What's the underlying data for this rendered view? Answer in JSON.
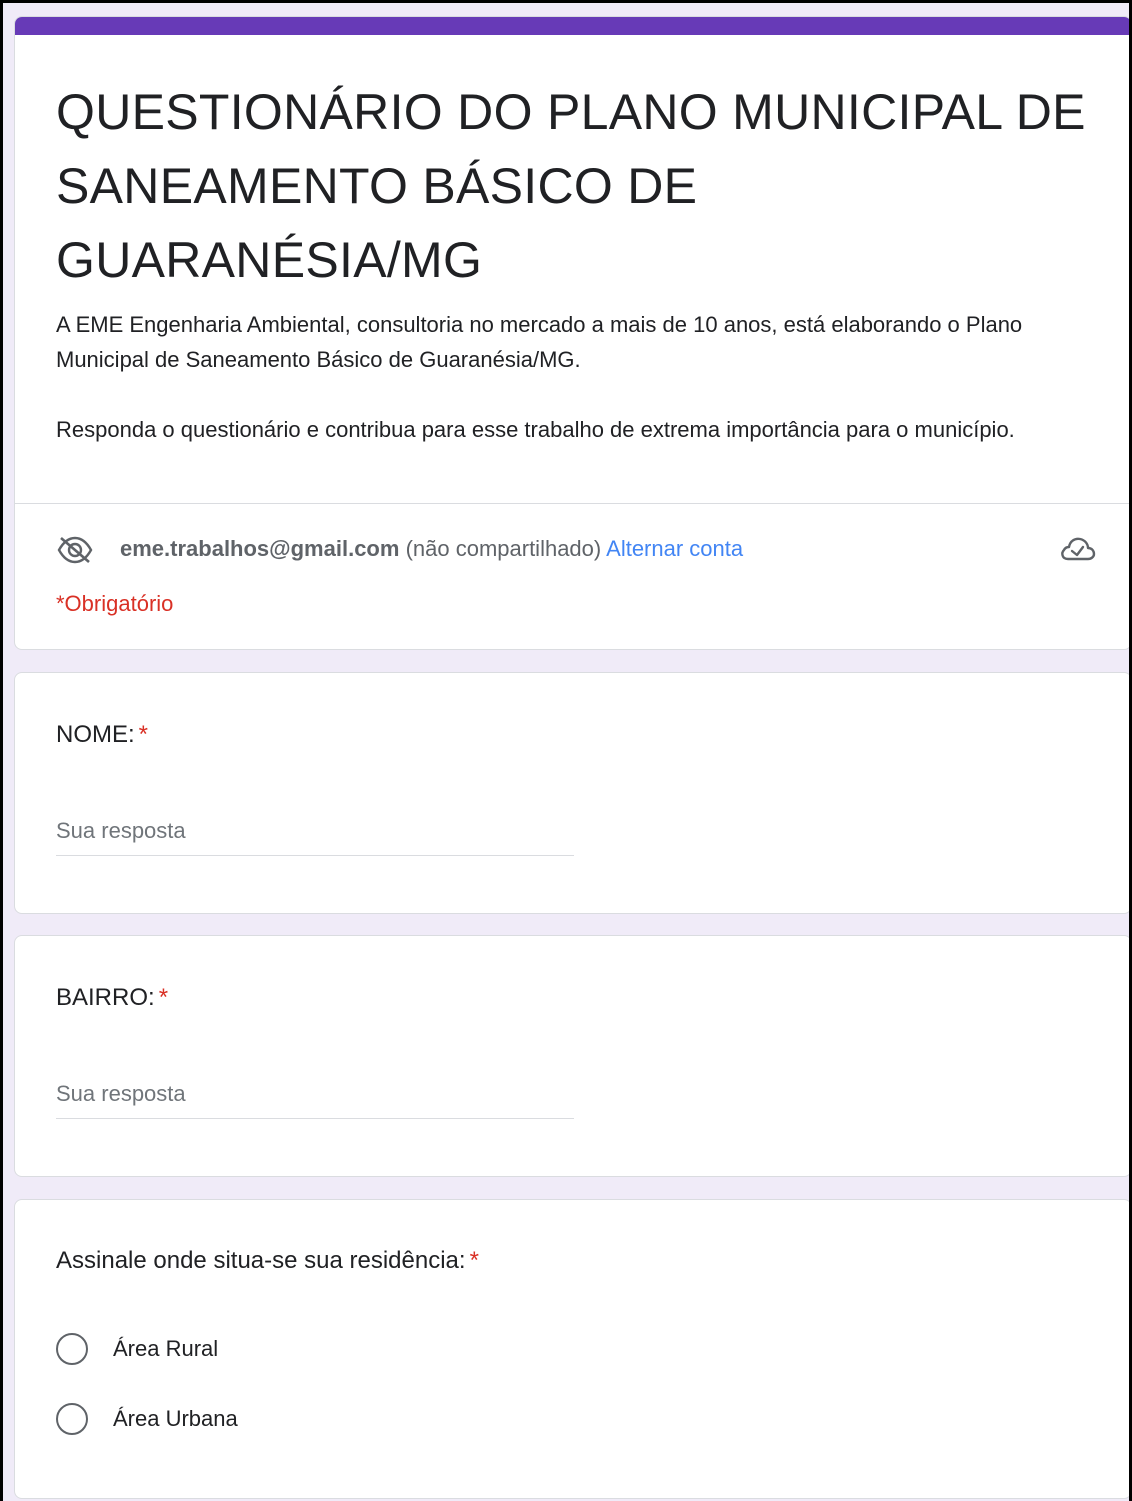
{
  "form": {
    "title": "QUESTIONÁRIO DO PLANO MUNICIPAL DE SANEAMENTO BÁSICO DE GUARANÉSIA/MG",
    "description": [
      "A EME Engenharia Ambiental, consultoria no mercado a mais de 10 anos, está elaborando o Plano Municipal de Saneamento Básico de Guaranésia/MG.",
      "Responda o questionário e contribua para esse trabalho de extrema importância para o município."
    ],
    "account": {
      "email": "eme.trabalhos@gmail.com",
      "shared_status": "(não compartilhado)",
      "switch_label": "Alternar conta"
    },
    "required_note": "*Obrigatório",
    "accent_color": "#673ab7"
  },
  "questions": [
    {
      "title": "NOME:",
      "required_mark": "*",
      "placeholder": "Sua resposta",
      "value": ""
    },
    {
      "title": "BAIRRO:",
      "required_mark": "*",
      "placeholder": "Sua resposta",
      "value": ""
    },
    {
      "title": "Assinale onde situa-se sua residência:",
      "required_mark": "*",
      "options": [
        "Área Rural",
        "Área Urbana"
      ],
      "selected": null
    }
  ],
  "icons": {
    "visibility": "eye-off-icon",
    "cloud": "cloud-done-icon"
  }
}
